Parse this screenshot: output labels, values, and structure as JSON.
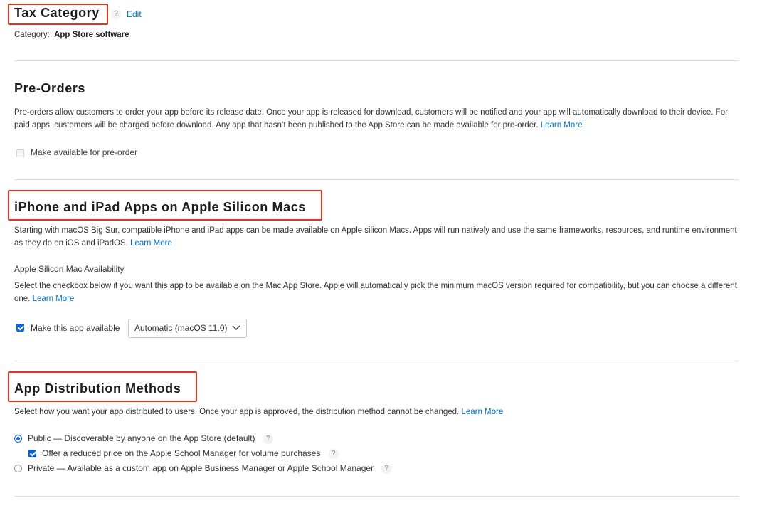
{
  "tax_category": {
    "title": "Tax Category",
    "help": "?",
    "edit_label": "Edit",
    "category_label": "Category:",
    "category_value": "App Store software"
  },
  "pre_orders": {
    "title": "Pre-Orders",
    "description": "Pre-orders allow customers to order your app before its release date. Once your app is released for download, customers will be notified and your app will automatically download to their device. For paid apps, customers will be charged before download. Any app that hasn’t been published to the App Store can be made available for pre-order.",
    "learn_more": "Learn More",
    "checkbox_label": "Make available for pre-order",
    "checkbox_checked": false
  },
  "silicon_macs": {
    "title": "iPhone and iPad Apps on Apple Silicon Macs",
    "description": "Starting with macOS Big Sur, compatible iPhone and iPad apps can be made available on Apple silicon Macs. Apps will run natively and use the same frameworks, resources, and runtime environment as they do on iOS and iPadOS.",
    "learn_more": "Learn More",
    "availability_heading": "Apple Silicon Mac Availability",
    "availability_description": "Select the checkbox below if you want this app to be available on the Mac App Store. Apple will automatically pick the minimum macOS version required for compatibility, but you can choose a different one.",
    "availability_learn_more": "Learn More",
    "checkbox_label": "Make this app available",
    "checkbox_checked": true,
    "version_select_value": "Automatic (macOS 11.0)"
  },
  "distribution": {
    "title": "App Distribution Methods",
    "description": "Select how you want your app distributed to users. Once your app is approved, the distribution method cannot be changed.",
    "learn_more": "Learn More",
    "public_label": "Public — Discoverable by anyone on the App Store (default)",
    "public_selected": true,
    "school_label": "Offer a reduced price on the Apple School Manager for volume purchases",
    "school_checked": true,
    "private_label": "Private — Available as a custom app on Apple Business Manager or Apple School Manager",
    "private_selected": false,
    "help": "?"
  },
  "colors": {
    "accent": "#0070c9",
    "highlight_border": "#d9381e",
    "control_blue": "#0a63d6"
  }
}
